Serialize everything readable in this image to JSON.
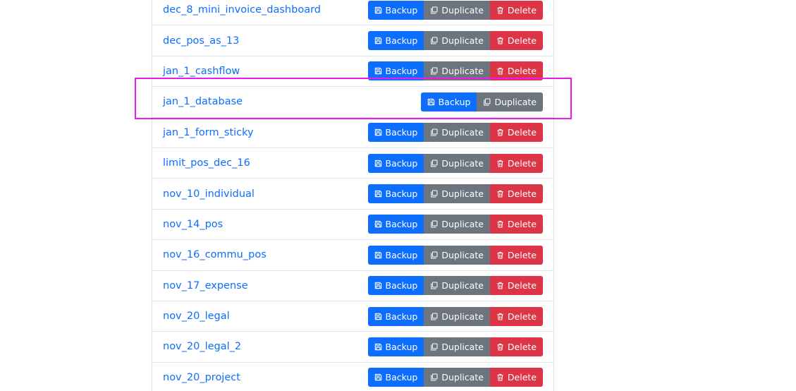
{
  "labels": {
    "backup": "Backup",
    "duplicate": "Duplicate",
    "delete": "Delete"
  },
  "icons": {
    "backup": "floppy-disk-icon",
    "duplicate": "copy-icon",
    "delete": "trash-icon"
  },
  "colors": {
    "link": "#0d6efd",
    "backup": "#0d6efd",
    "duplicate": "#6c757d",
    "delete": "#dc3545",
    "highlight": "#e81ce8"
  },
  "databases": [
    {
      "name": "dec_8_mini_invoice_dashboard",
      "deletable": true
    },
    {
      "name": "dec_pos_as_13",
      "deletable": true
    },
    {
      "name": "jan_1_cashflow",
      "deletable": true
    },
    {
      "name": "jan_1_database",
      "deletable": false,
      "highlighted": true
    },
    {
      "name": "jan_1_form_sticky",
      "deletable": true
    },
    {
      "name": "limit_pos_dec_16",
      "deletable": true
    },
    {
      "name": "nov_10_individual",
      "deletable": true
    },
    {
      "name": "nov_14_pos",
      "deletable": true
    },
    {
      "name": "nov_16_commu_pos",
      "deletable": true
    },
    {
      "name": "nov_17_expense",
      "deletable": true
    },
    {
      "name": "nov_20_legal",
      "deletable": true
    },
    {
      "name": "nov_20_legal_2",
      "deletable": true
    },
    {
      "name": "nov_20_project",
      "deletable": true
    }
  ]
}
